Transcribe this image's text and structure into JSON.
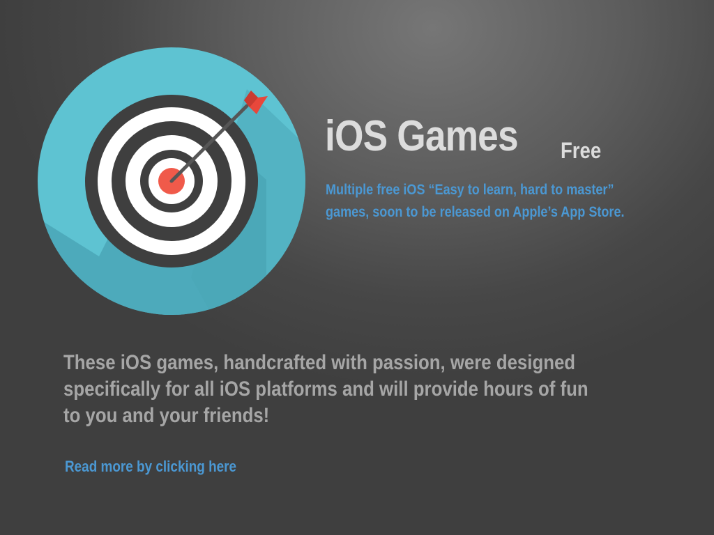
{
  "icon": {
    "name": "target-with-arrow-icon",
    "colors": {
      "disc": "#5ec3d2",
      "shadow": "#4aa6b7",
      "dark_ring": "#3f3f3f",
      "white_ring": "#ffffff",
      "bullseye": "#f05a4a",
      "arrow_shaft": "#565656",
      "fletching": "#e8473b"
    }
  },
  "header": {
    "title": "iOS Games",
    "badge": "Free"
  },
  "subtitle": {
    "lines": [
      "Multiple free iOS “Easy to learn, hard to master”",
      "games, soon to be released on Apple’s App Store."
    ]
  },
  "description": {
    "lines": [
      "These iOS games, handcrafted with passion, were designed",
      "specifically for all iOS platforms and will provide hours of fun",
      "to you and your friends!"
    ]
  },
  "link": {
    "label": "Read more by clicking here"
  },
  "colors": {
    "title_text": "#dcdcdc",
    "accent_blue": "#4b98d3",
    "body_text": "#a6a6a6",
    "background": "#555555"
  }
}
